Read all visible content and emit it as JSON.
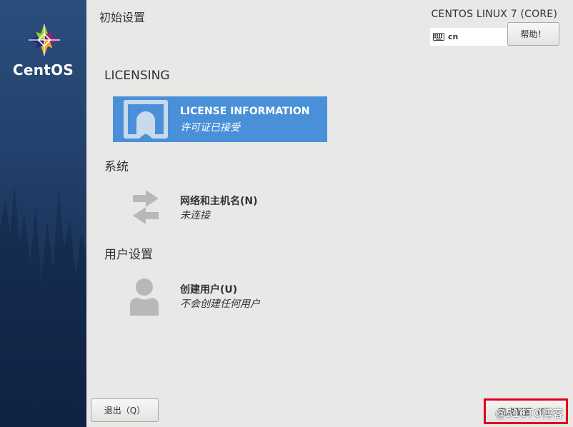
{
  "sidebar": {
    "brand_name": "CentOS"
  },
  "header": {
    "page_title": "初始设置",
    "product_title": "CENTOS LINUX 7 (CORE)",
    "keyboard_layout": "cn",
    "help_label": "帮助！"
  },
  "sections": {
    "licensing": {
      "heading": "LICENSING",
      "spoke": {
        "title": "LICENSE INFORMATION",
        "status": "许可证已接受",
        "icon": "license-certificate-icon"
      }
    },
    "system": {
      "heading": "系统",
      "spoke": {
        "title": "网络和主机名(N)",
        "status": "未连接",
        "icon": "network-arrows-icon"
      }
    },
    "user_settings": {
      "heading": "用户设置",
      "spoke": {
        "title": "创建用户(U)",
        "status": "不会创建任何用户",
        "icon": "user-icon"
      }
    }
  },
  "footer": {
    "quit_label": "退出（Q）",
    "finish_label": "完成配置（F）"
  },
  "watermark": "@51CTO博客",
  "colors": {
    "sidebar": "#23416c",
    "selected_spoke": "#4a90d9",
    "background": "#e8e8e7",
    "highlight_box": "#e0001b"
  }
}
